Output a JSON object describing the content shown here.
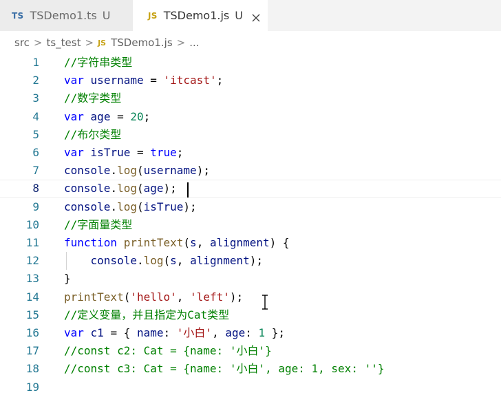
{
  "tabs": [
    {
      "badge": "TS",
      "name": "TSDemo1.ts",
      "status": "U",
      "active": false
    },
    {
      "badge": "JS",
      "name": "TSDemo1.js",
      "status": "U",
      "active": true
    }
  ],
  "breadcrumb": {
    "folder1": "src",
    "folder2": "ts_test",
    "file_badge": "JS",
    "file": "TSDemo1.js",
    "ellipsis": "..."
  },
  "editor": {
    "active_line": 8,
    "lines": [
      {
        "n": "1",
        "text": "//字符串类型"
      },
      {
        "n": "2",
        "text": "var username = 'itcast';"
      },
      {
        "n": "3",
        "text": "//数字类型"
      },
      {
        "n": "4",
        "text": "var age = 20;"
      },
      {
        "n": "5",
        "text": "//布尔类型"
      },
      {
        "n": "6",
        "text": "var isTrue = true;"
      },
      {
        "n": "7",
        "text": "console.log(username);"
      },
      {
        "n": "8",
        "text": "console.log(age);"
      },
      {
        "n": "9",
        "text": "console.log(isTrue);"
      },
      {
        "n": "10",
        "text": "//字面量类型"
      },
      {
        "n": "11",
        "text": "function printText(s, alignment) {"
      },
      {
        "n": "12",
        "text": "    console.log(s, alignment);"
      },
      {
        "n": "13",
        "text": "}"
      },
      {
        "n": "14",
        "text": "printText('hello', 'left');"
      },
      {
        "n": "15",
        "text": "//定义变量，并且指定为Cat类型"
      },
      {
        "n": "16",
        "text": "var c1 = { name: '小白', age: 1 };"
      },
      {
        "n": "17",
        "text": "//const c2: Cat = {name: '小白'}"
      },
      {
        "n": "18",
        "text": "//const c3: Cat = {name: '小白', age: 1, sex: ''}"
      },
      {
        "n": "19",
        "text": ""
      }
    ]
  },
  "icons": {
    "tab_close": "close-icon",
    "text_cursor": "ibeam-cursor-icon"
  },
  "colors": {
    "comment": "#008000",
    "keyword": "#0000ff",
    "string": "#a31515",
    "number": "#098658",
    "function": "#795e26",
    "variable": "#001080",
    "line_number": "#237893",
    "ts_badge": "#3b6fa6",
    "js_badge": "#c8a316"
  }
}
